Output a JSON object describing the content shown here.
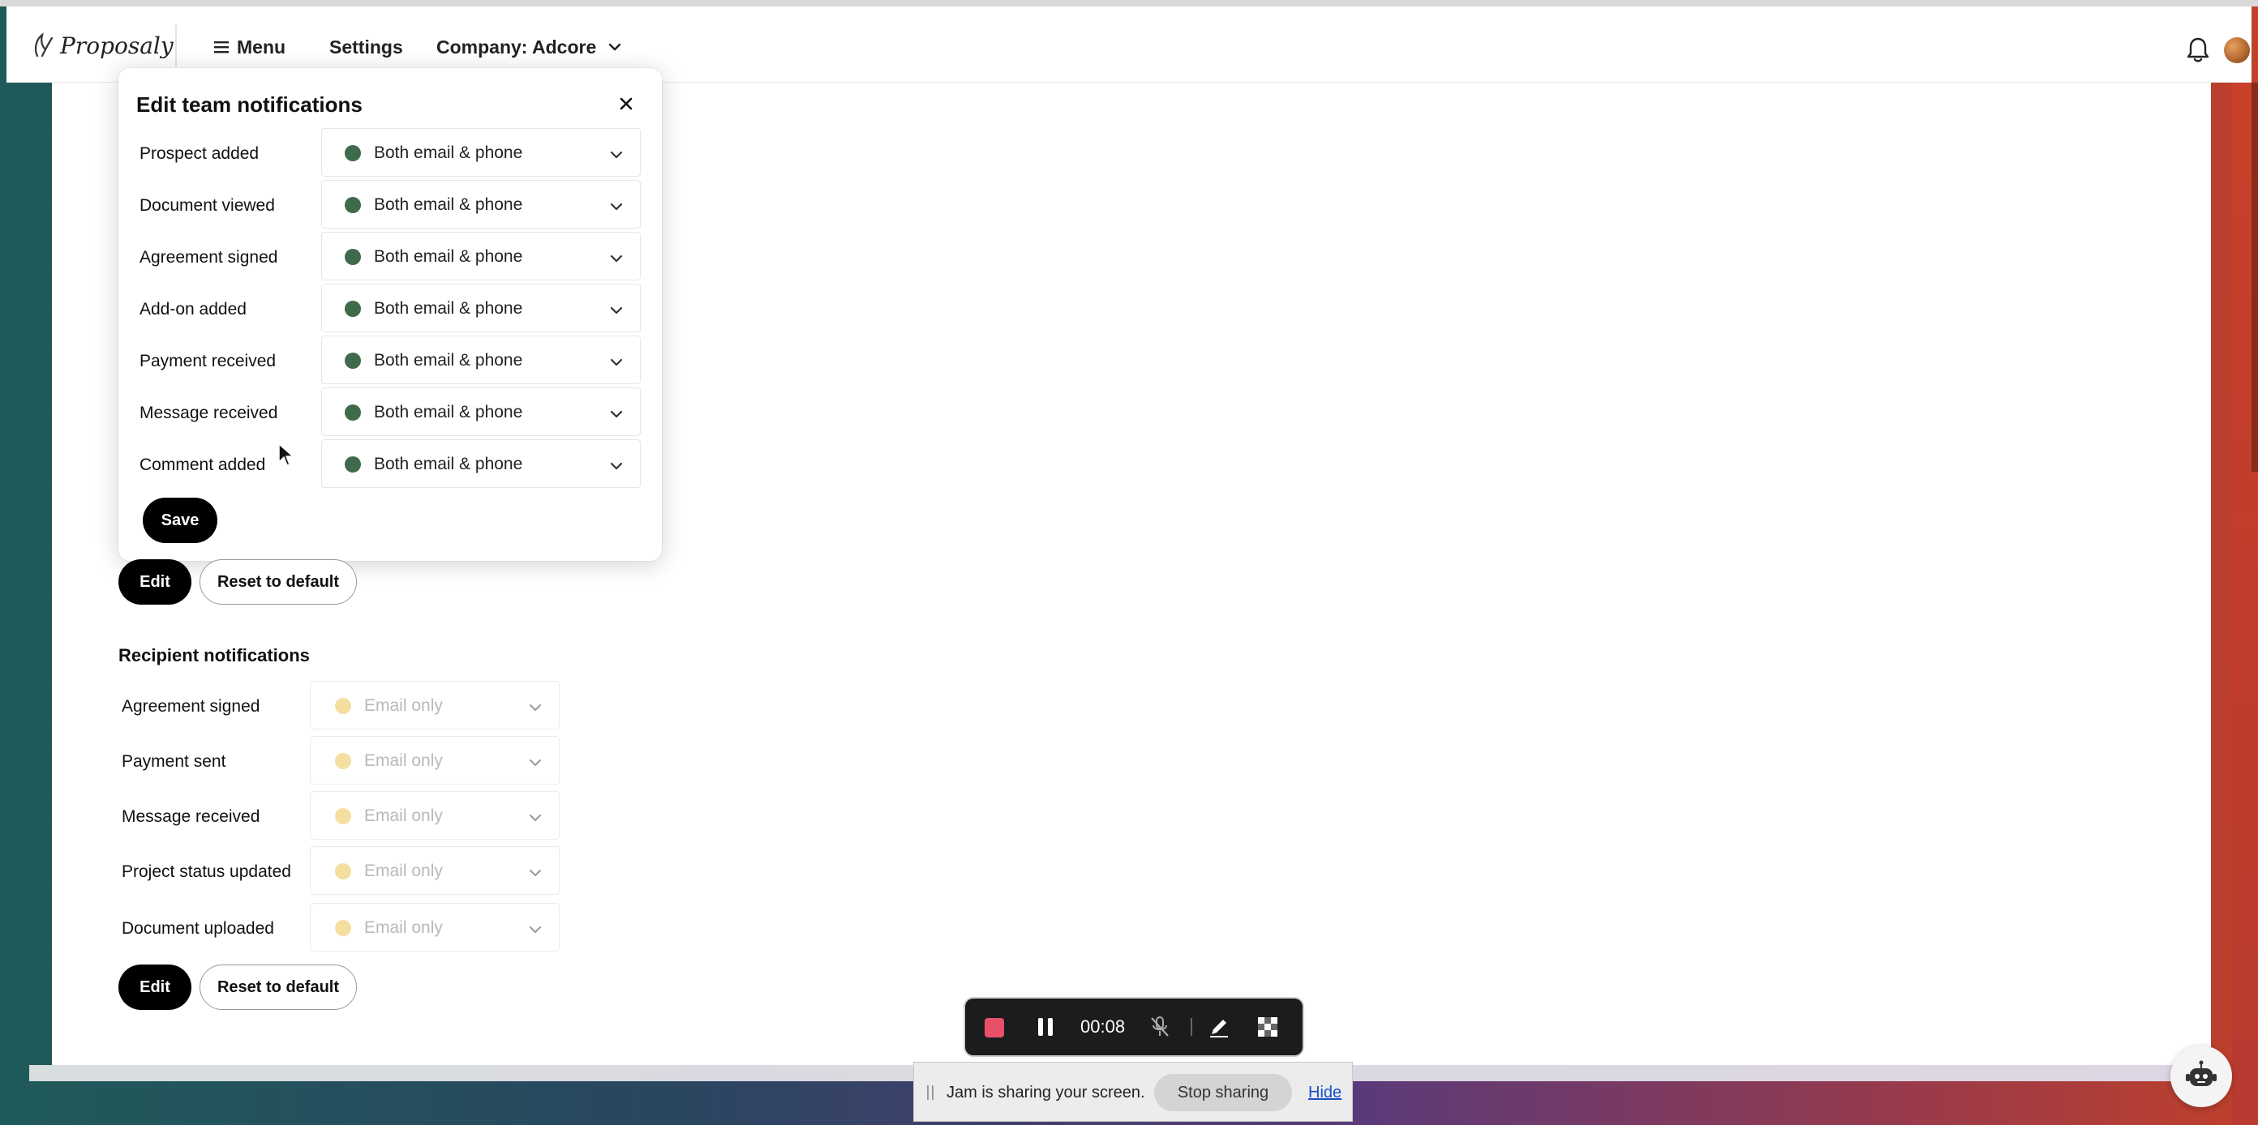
{
  "brand": {
    "name": "Proposaly"
  },
  "nav": {
    "menu_label": "Menu",
    "settings_label": "Settings",
    "company_label": "Company: Adcore"
  },
  "modal": {
    "title": "Edit team notifications",
    "rows": [
      {
        "label": "Prospect added",
        "value": "Both email & phone"
      },
      {
        "label": "Document viewed",
        "value": "Both email & phone"
      },
      {
        "label": "Agreement signed",
        "value": "Both email & phone"
      },
      {
        "label": "Add-on added",
        "value": "Both email & phone"
      },
      {
        "label": "Payment received",
        "value": "Both email & phone"
      },
      {
        "label": "Message received",
        "value": "Both email & phone"
      },
      {
        "label": "Comment added",
        "value": "Both email & phone"
      }
    ],
    "save_label": "Save",
    "status_color": "#3f6b4c"
  },
  "team_actions": {
    "edit_label": "Edit",
    "reset_label": "Reset to default"
  },
  "recipient": {
    "title": "Recipient notifications",
    "rows": [
      {
        "label": "Agreement signed",
        "value": "Email only"
      },
      {
        "label": "Payment sent",
        "value": "Email only"
      },
      {
        "label": "Message received",
        "value": "Email only"
      },
      {
        "label": "Project status updated",
        "value": "Email only"
      },
      {
        "label": "Document uploaded",
        "value": "Email only"
      }
    ],
    "status_color": "#f4dfa0",
    "edit_label": "Edit",
    "reset_label": "Reset to default"
  },
  "recorder": {
    "timer": "00:08"
  },
  "share_bar": {
    "message": "Jam is sharing your screen.",
    "stop_label": "Stop sharing",
    "hide_label": "Hide"
  }
}
